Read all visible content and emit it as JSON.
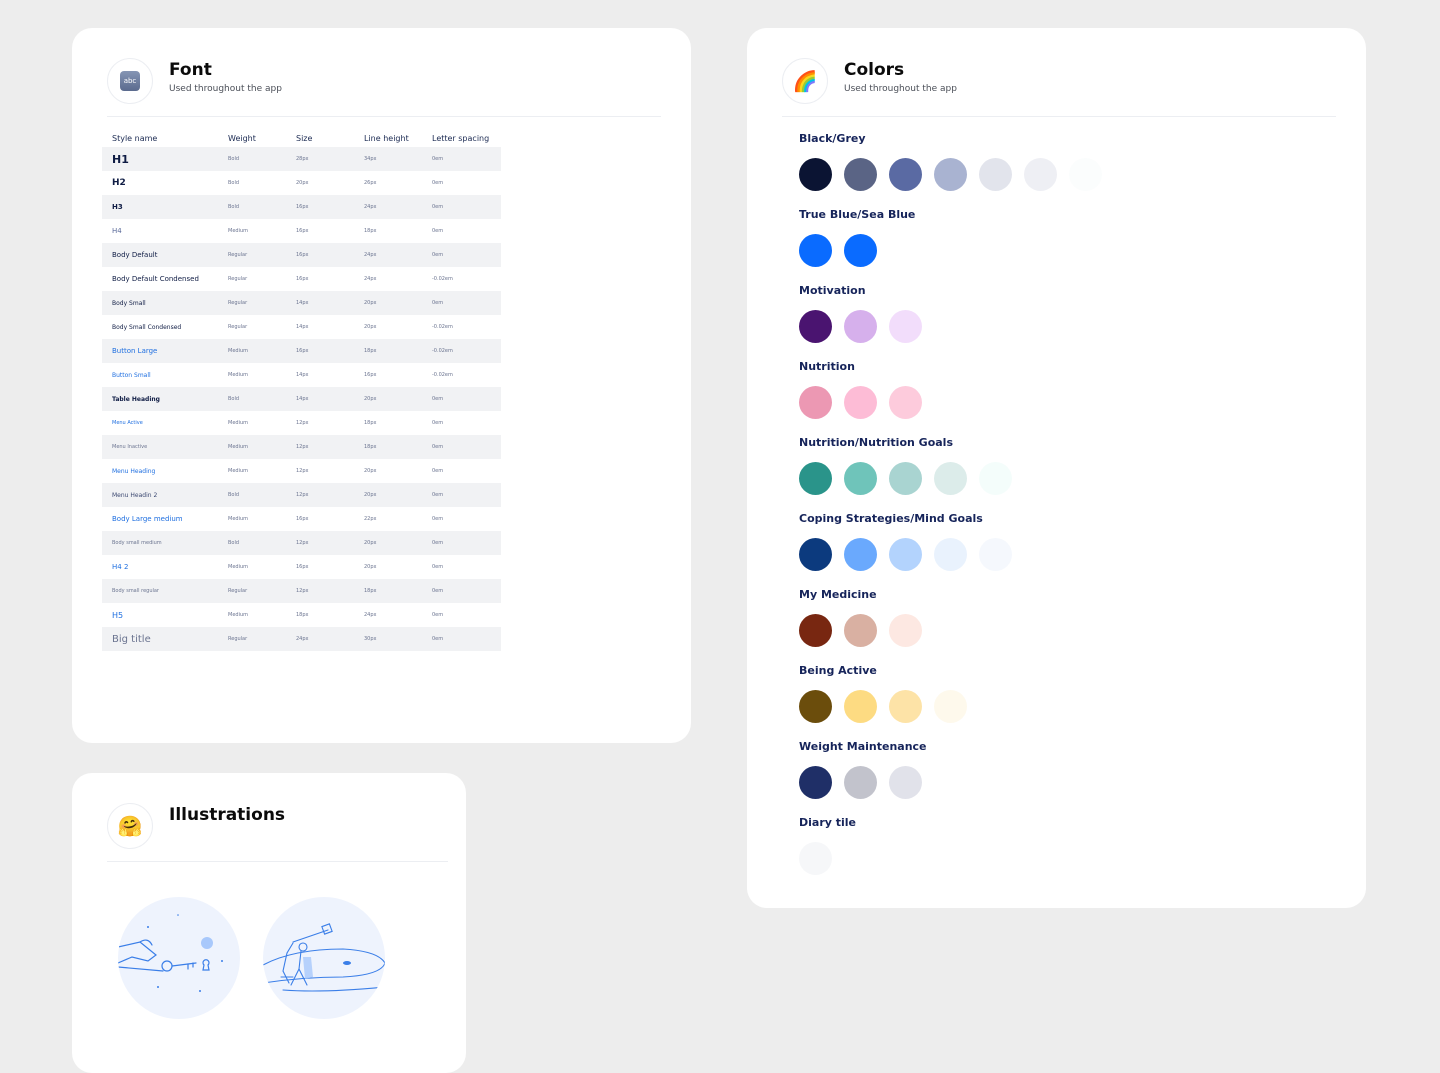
{
  "font_card": {
    "title": "Font",
    "subtitle": "Used throughout the app",
    "icon": "abc-icon",
    "icon_text": "abc",
    "columns": [
      "Style name",
      "Weight",
      "Size",
      "Line height",
      "Letter spacing"
    ],
    "rows": [
      {
        "name": "H1",
        "weight": "Bold",
        "size": "28px",
        "line_height": "34px",
        "spacing": "0em",
        "fs": 11,
        "fw": "bold",
        "color": "#0f1c44"
      },
      {
        "name": "H2",
        "weight": "Bold",
        "size": "20px",
        "line_height": "26px",
        "spacing": "0em",
        "fs": 9,
        "fw": "bold",
        "color": "#0f1c44"
      },
      {
        "name": "H3",
        "weight": "Bold",
        "size": "16px",
        "line_height": "24px",
        "spacing": "0em",
        "fs": 7,
        "fw": "bold",
        "color": "#0f1c44"
      },
      {
        "name": "H4",
        "weight": "Medium",
        "size": "16px",
        "line_height": "18px",
        "spacing": "0em",
        "fs": 7,
        "fw": "normal",
        "color": "#5a6a9a"
      },
      {
        "name": "Body Default",
        "weight": "Regular",
        "size": "16px",
        "line_height": "24px",
        "spacing": "0em",
        "fs": 7,
        "fw": "normal",
        "color": "#0f1c44"
      },
      {
        "name": "Body Default Condensed",
        "weight": "Regular",
        "size": "16px",
        "line_height": "24px",
        "spacing": "-0.02em",
        "fs": 7,
        "fw": "normal",
        "color": "#0f1c44"
      },
      {
        "name": "Body Small",
        "weight": "Regular",
        "size": "14px",
        "line_height": "20px",
        "spacing": "0em",
        "fs": 6,
        "fw": "normal",
        "color": "#0f1c44"
      },
      {
        "name": "Body Small Condensed",
        "weight": "Regular",
        "size": "14px",
        "line_height": "20px",
        "spacing": "-0.02em",
        "fs": 6,
        "fw": "normal",
        "color": "#0f1c44"
      },
      {
        "name": "Button Large",
        "weight": "Medium",
        "size": "16px",
        "line_height": "18px",
        "spacing": "-0.02em",
        "fs": 7,
        "fw": "normal",
        "color": "#1f6fe0"
      },
      {
        "name": "Button Small",
        "weight": "Medium",
        "size": "14px",
        "line_height": "16px",
        "spacing": "-0.02em",
        "fs": 6,
        "fw": "normal",
        "color": "#1f6fe0"
      },
      {
        "name": "Table Heading",
        "weight": "Bold",
        "size": "14px",
        "line_height": "20px",
        "spacing": "0em",
        "fs": 6,
        "fw": "bold",
        "color": "#0f1c44"
      },
      {
        "name": "Menu Active",
        "weight": "Medium",
        "size": "12px",
        "line_height": "18px",
        "spacing": "0em",
        "fs": 5,
        "fw": "normal",
        "color": "#1f6fe0"
      },
      {
        "name": "Menu Inactive",
        "weight": "Medium",
        "size": "12px",
        "line_height": "18px",
        "spacing": "0em",
        "fs": 5,
        "fw": "normal",
        "color": "#6b7490"
      },
      {
        "name": "Menu Heading",
        "weight": "Medium",
        "size": "12px",
        "line_height": "20px",
        "spacing": "0em",
        "fs": 6,
        "fw": "normal",
        "color": "#1f6fe0"
      },
      {
        "name": "Menu Headin 2",
        "weight": "Bold",
        "size": "12px",
        "line_height": "20px",
        "spacing": "0em",
        "fs": 6,
        "fw": "normal",
        "color": "#3a4770"
      },
      {
        "name": "Body Large medium",
        "weight": "Medium",
        "size": "16px",
        "line_height": "22px",
        "spacing": "0em",
        "fs": 7,
        "fw": "normal",
        "color": "#1f6fe0"
      },
      {
        "name": "Body small medium",
        "weight": "Bold",
        "size": "12px",
        "line_height": "20px",
        "spacing": "0em",
        "fs": 5,
        "fw": "normal",
        "color": "#6b7490"
      },
      {
        "name": "H4 2",
        "weight": "Medium",
        "size": "16px",
        "line_height": "20px",
        "spacing": "0em",
        "fs": 7,
        "fw": "normal",
        "color": "#1f6fe0"
      },
      {
        "name": "Body small regular",
        "weight": "Regular",
        "size": "12px",
        "line_height": "18px",
        "spacing": "0em",
        "fs": 5,
        "fw": "normal",
        "color": "#6b7490"
      },
      {
        "name": "H5",
        "weight": "Medium",
        "size": "18px",
        "line_height": "24px",
        "spacing": "0em",
        "fs": 8,
        "fw": "normal",
        "color": "#1f6fe0"
      },
      {
        "name": "Big title",
        "weight": "Regular",
        "size": "24px",
        "line_height": "30px",
        "spacing": "0em",
        "fs": 10,
        "fw": "normal",
        "color": "#6b7490"
      }
    ]
  },
  "colors_card": {
    "title": "Colors",
    "subtitle": "Used throughout the app",
    "icon": "rainbow-icon",
    "icon_glyph": "🌈",
    "groups": [
      {
        "name": "Black/Grey",
        "colors": [
          "#0b1433",
          "#5a6485",
          "#5a6aa3",
          "#a9b3d1",
          "#e2e4ec",
          "#eeeff4",
          "#fbfdfd"
        ]
      },
      {
        "name": "True Blue/Sea Blue",
        "colors": [
          "#0a6bff",
          "#0a6bff"
        ]
      },
      {
        "name": "Motivation",
        "colors": [
          "#4a1470",
          "#d6b0ec",
          "#f2ddfb"
        ]
      },
      {
        "name": "Nutrition",
        "colors": [
          "#ec98b3",
          "#fdbcd6",
          "#fdcbdc"
        ]
      },
      {
        "name": "Nutrition/Nutrition Goals",
        "colors": [
          "#2a948a",
          "#6fc4ba",
          "#a9d4d1",
          "#dcecea",
          "#f4fdfb"
        ]
      },
      {
        "name": "Coping Strategies/Mind Goals",
        "colors": [
          "#0c3a7e",
          "#6aa9fd",
          "#b3d3fd",
          "#e9f2fd",
          "#f5f8fd"
        ]
      },
      {
        "name": "My Medicine",
        "colors": [
          "#782711",
          "#d9b0a2",
          "#fde8e2"
        ]
      },
      {
        "name": "Being Active",
        "colors": [
          "#6b4d0c",
          "#fddb82",
          "#fde3a7",
          "#fef9ec"
        ]
      },
      {
        "name": "Weight Maintenance",
        "colors": [
          "#1f2f67",
          "#c2c3cc",
          "#e1e2ea"
        ]
      },
      {
        "name": "Diary tile",
        "colors": [
          "#f6f7f9"
        ]
      }
    ]
  },
  "illustrations_card": {
    "title": "Illustrations",
    "icon": "hugging-face-icon",
    "icon_glyph": "🤗",
    "items": [
      "key-illustration",
      "telescope-illustration"
    ]
  }
}
